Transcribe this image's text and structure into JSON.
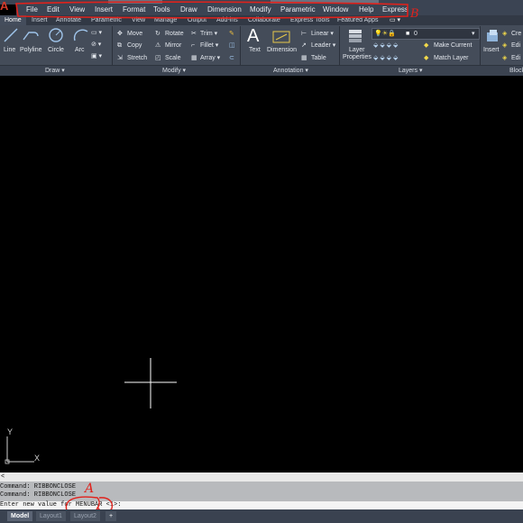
{
  "app": {
    "logo_letter": "A"
  },
  "menubar": {
    "items": [
      "File",
      "Edit",
      "View",
      "Insert",
      "Format",
      "Tools",
      "Draw",
      "Dimension",
      "Modify",
      "Parametric",
      "Window",
      "Help",
      "Express"
    ]
  },
  "tabs": {
    "items": [
      "Home",
      "Insert",
      "Annotate",
      "Parametric",
      "View",
      "Manage",
      "Output",
      "Add-ins",
      "Collaborate",
      "Express Tools",
      "Featured Apps"
    ],
    "active": "Home"
  },
  "ribbon": {
    "draw": {
      "line": "Line",
      "polyline": "Polyline",
      "circle": "Circle",
      "arc": "Arc",
      "group": "Draw ▾"
    },
    "modify": {
      "move": "Move",
      "rotate": "Rotate",
      "trim": "Trim ▾",
      "copy": "Copy",
      "mirror": "Mirror",
      "fillet": "Fillet ▾",
      "stretch": "Stretch",
      "scale": "Scale",
      "array": "Array ▾",
      "group": "Modify ▾"
    },
    "annotation": {
      "text": "Text",
      "dimension": "Dimension",
      "linear": "Linear ▾",
      "leader": "Leader ▾",
      "table": "Table",
      "group": "Annotation ▾"
    },
    "layers": {
      "properties_line1": "Layer",
      "properties_line2": "Properties",
      "current_layer": "0",
      "make_current": "Make Current",
      "match_layer": "Match Layer",
      "group": "Layers ▾"
    },
    "block": {
      "insert": "Insert",
      "create": "Cre",
      "edit1": "Edi",
      "edit2": "Edi",
      "group": "Block"
    }
  },
  "ucs": {
    "x": "X",
    "y": "Y"
  },
  "command": {
    "collapse": "<",
    "history": [
      "Command:  RIBBONCLOSE",
      "Command:  RIBBONCLOSE"
    ],
    "prompt": "Enter new value for MENUBAR <1>:"
  },
  "annotations": {
    "label_a": "A",
    "label_b": "B"
  },
  "layouts": {
    "items": [
      "Model",
      "Layout1",
      "Layout2"
    ],
    "add": "+"
  },
  "colors": {
    "annotation_red": "#e0221c",
    "menubar_bg": "#3b4453",
    "ribbon_bg": "#444c59"
  }
}
